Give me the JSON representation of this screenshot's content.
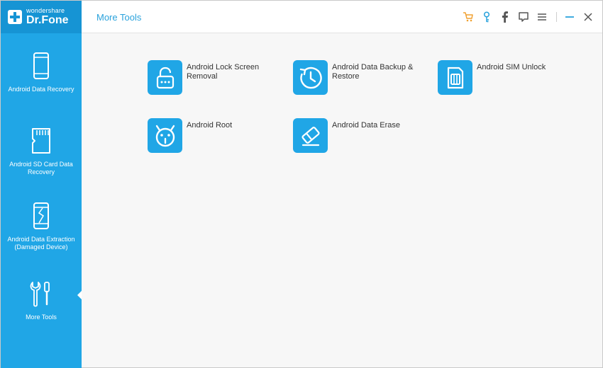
{
  "app": {
    "logo_small": "wondershare",
    "logo_big": "Dr.Fone"
  },
  "header": {
    "title": "More Tools"
  },
  "toolbar": {
    "icons": [
      "cart-icon",
      "key-icon",
      "facebook-icon",
      "feedback-icon",
      "menu-icon",
      "minimize-icon",
      "close-icon"
    ]
  },
  "sidebar": {
    "items": [
      {
        "label": "Android Data Recovery",
        "icon": "phone-icon"
      },
      {
        "label": "Android SD Card Data Recovery",
        "icon": "sd-card-icon"
      },
      {
        "label": "Android Data Extraction (Damaged Device)",
        "icon": "broken-phone-icon"
      },
      {
        "label": "More Tools",
        "icon": "tools-icon",
        "selected": true
      }
    ]
  },
  "tools": [
    {
      "label": "Android Lock Screen Removal",
      "icon": "lock-icon"
    },
    {
      "label": "Android Data Backup & Restore",
      "icon": "backup-clock-icon"
    },
    {
      "label": "Android SIM Unlock",
      "icon": "sim-card-icon"
    },
    {
      "label": "Android Root",
      "icon": "android-root-icon"
    },
    {
      "label": "Android Data Erase",
      "icon": "eraser-icon"
    }
  ],
  "colors": {
    "sidebar": "#20a6e6",
    "logo_bg": "#1694d4",
    "accent": "#2aa2dc",
    "cart": "#f0a030",
    "key": "#2aa2dc"
  }
}
